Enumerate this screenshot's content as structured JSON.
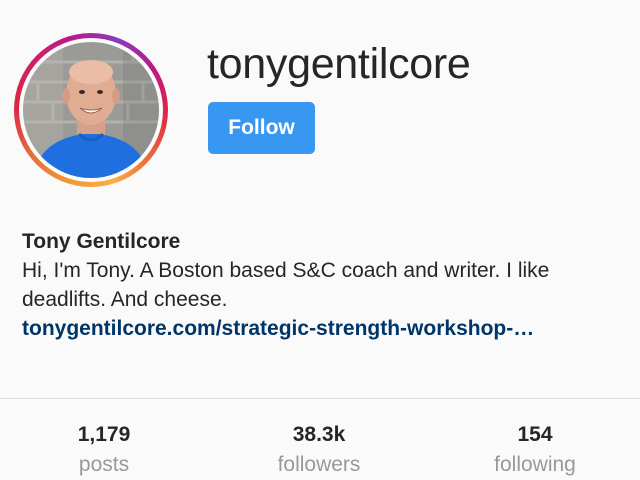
{
  "profile": {
    "username": "tonygentilcore",
    "follow_label": "Follow",
    "full_name": "Tony Gentilcore",
    "bio": "Hi, I'm Tony. A Boston based S&C coach and writer. I like deadlifts. And cheese.",
    "link": "tonygentilcore.com/strategic-strength-workshop-…",
    "avatar_icon": "profile-photo"
  },
  "stats": {
    "posts": {
      "value": "1,179",
      "label": "posts"
    },
    "followers": {
      "value": "38.3k",
      "label": "followers"
    },
    "following": {
      "value": "154",
      "label": "following"
    }
  },
  "colors": {
    "accent": "#3897f0",
    "link": "#003569",
    "muted": "#999999"
  }
}
